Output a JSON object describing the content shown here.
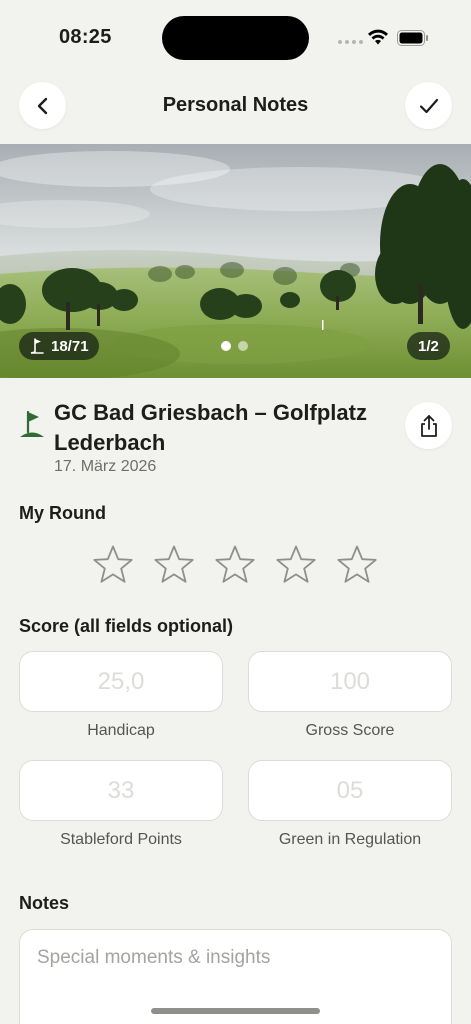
{
  "status_bar": {
    "time": "08:25"
  },
  "nav": {
    "title": "Personal Notes",
    "back_icon": "chevron-left-icon",
    "done_icon": "checkmark-icon"
  },
  "hero": {
    "holes_label": "18/71",
    "image_counter": "1/2",
    "page_count": 2,
    "active_page": 1
  },
  "course": {
    "name": "GC Bad Griesbach – Golfplatz Lederbach",
    "date": "17. März 2026",
    "icon": "golf-flag-icon",
    "share_icon": "share-icon"
  },
  "my_round": {
    "title": "My Round",
    "rating": 0,
    "max_rating": 5
  },
  "score": {
    "title": "Score  (all fields optional)",
    "fields": [
      {
        "label": "Handicap",
        "placeholder": "25,0",
        "value": ""
      },
      {
        "label": "Gross Score",
        "placeholder": "100",
        "value": ""
      },
      {
        "label": "Stableford Points",
        "placeholder": "33",
        "value": ""
      },
      {
        "label": "Green in Regulation",
        "placeholder": "05",
        "value": ""
      }
    ]
  },
  "notes": {
    "title": "Notes",
    "placeholder": "Special moments & insights",
    "value": ""
  },
  "colors": {
    "background": "#f2f2ee",
    "accent_green": "#2f6b35",
    "field_border": "#dcdcd8"
  }
}
